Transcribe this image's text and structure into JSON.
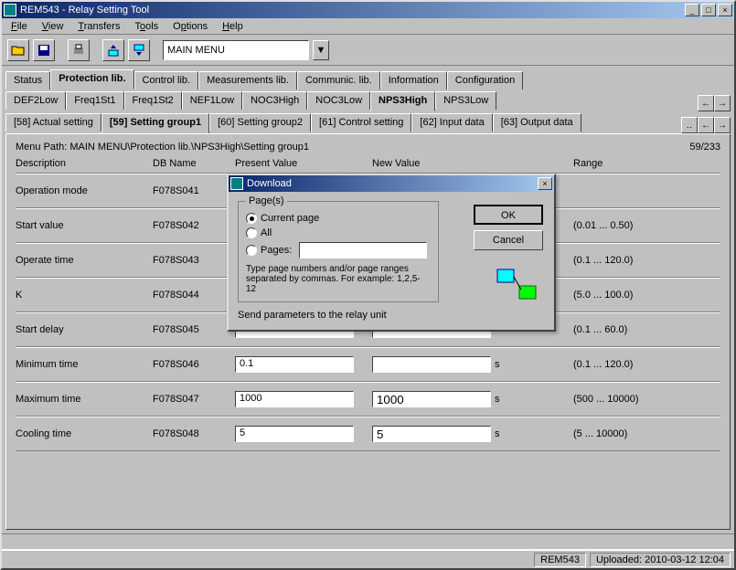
{
  "window": {
    "title": "REM543 - Relay Setting Tool"
  },
  "menu": {
    "file": "File",
    "view": "View",
    "transfers": "Transfers",
    "tools": "Tools",
    "options": "Options",
    "help": "Help"
  },
  "toolbar": {
    "main_menu": "MAIN MENU"
  },
  "tabs_main": [
    {
      "label": "Status"
    },
    {
      "label": "Protection lib.",
      "active": true
    },
    {
      "label": "Control lib."
    },
    {
      "label": "Measurements lib."
    },
    {
      "label": "Communic. lib."
    },
    {
      "label": "Information"
    },
    {
      "label": "Configuration"
    }
  ],
  "tabs_sub": [
    {
      "label": "DEF2Low"
    },
    {
      "label": "Freq1St1"
    },
    {
      "label": "Freq1St2"
    },
    {
      "label": "NEF1Low"
    },
    {
      "label": "NOC3High"
    },
    {
      "label": "NOC3Low"
    },
    {
      "label": "NPS3High",
      "active": true
    },
    {
      "label": "NPS3Low"
    }
  ],
  "tabs_page": [
    {
      "label": "[58] Actual setting"
    },
    {
      "label": "[59] Setting group1",
      "active": true
    },
    {
      "label": "[60] Setting group2"
    },
    {
      "label": "[61] Control setting"
    },
    {
      "label": "[62] Input data"
    },
    {
      "label": "[63] Output data"
    }
  ],
  "menu_path": "Menu Path: MAIN MENU\\Protection lib.\\NPS3High\\Setting group1",
  "page_indicator": "59/233",
  "columns": {
    "desc": "Description",
    "db": "DB Name",
    "pv": "Present Value",
    "nv": "New Value",
    "range": "Range"
  },
  "rows": [
    {
      "desc": "Operation mode",
      "db": "F078S041",
      "pv": "",
      "nv": "",
      "unit": "",
      "range": ""
    },
    {
      "desc": "Start value",
      "db": "F078S042",
      "pv": "",
      "nv": "",
      "unit": "",
      "range": "(0.01 ... 0.50)"
    },
    {
      "desc": "Operate time",
      "db": "F078S043",
      "pv": "",
      "nv": "",
      "unit": "",
      "range": "(0.1 ... 120.0)"
    },
    {
      "desc": "K",
      "db": "F078S044",
      "pv": "",
      "nv": "",
      "unit": "",
      "range": "(5.0 ... 100.0)"
    },
    {
      "desc": "Start delay",
      "db": "F078S045",
      "pv": "",
      "nv": "",
      "unit": "",
      "range": "(0.1 ... 60.0)"
    },
    {
      "desc": "Minimum time",
      "db": "F078S046",
      "pv": "0.1",
      "nv": "",
      "unit": "s",
      "range": "(0.1 ... 120.0)"
    },
    {
      "desc": "Maximum time",
      "db": "F078S047",
      "pv": "1000",
      "nv": "1000",
      "unit": "s",
      "range": "(500 ... 10000)"
    },
    {
      "desc": "Cooling time",
      "db": "F078S048",
      "pv": "5",
      "nv": "5",
      "unit": "s",
      "range": "(5 ... 10000)"
    }
  ],
  "status": {
    "device": "REM543",
    "uploaded": "Uploaded: 2010-03-12 12:04"
  },
  "modal": {
    "title": "Download",
    "group_label": "Page(s)",
    "opt_current": "Current page",
    "opt_all": "All",
    "opt_pages": "Pages:",
    "hint": "Type page numbers and/or page ranges separated by commas. For example: 1,2,5-12",
    "send_text": "Send parameters to the relay unit",
    "ok": "OK",
    "cancel": "Cancel"
  }
}
